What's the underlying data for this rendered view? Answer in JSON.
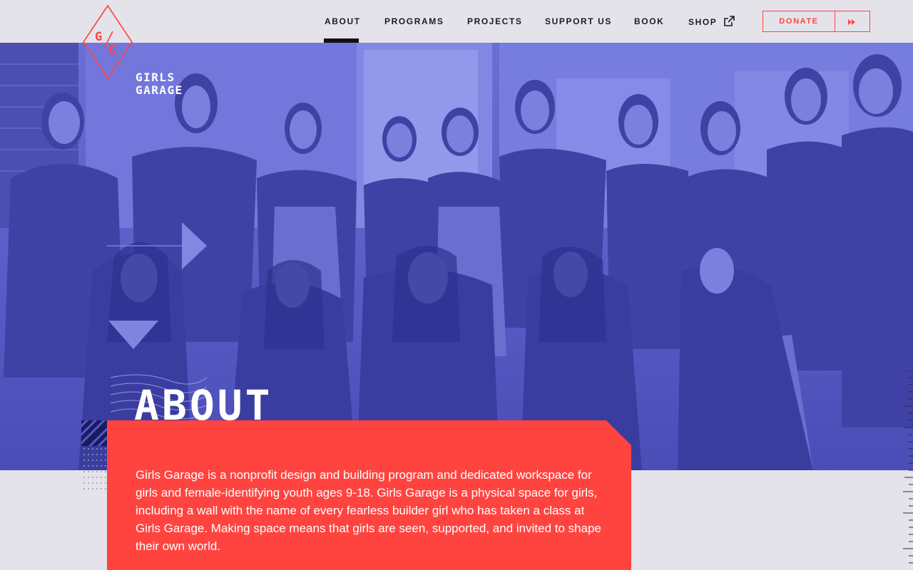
{
  "brand": {
    "monogram": "G/G",
    "name_line1": "GIRLS",
    "name_line2": "GARAGE",
    "color_red": "#ff4440",
    "color_blue": "#5558c4"
  },
  "nav": {
    "items": [
      {
        "label": "ABOUT",
        "active": true
      },
      {
        "label": "PROGRAMS",
        "active": false
      },
      {
        "label": "PROJECTS",
        "active": false
      },
      {
        "label": "SUPPORT US",
        "active": false
      },
      {
        "label": "BOOK",
        "active": false
      },
      {
        "label": "SHOP",
        "active": false
      }
    ],
    "shop_icon": "external-link-icon",
    "donate_label": "DONATE",
    "donate_icon": "fast-forward-icon"
  },
  "hero": {
    "title": "ABOUT",
    "image": "group-photo-of-girls-with-tools"
  },
  "intro": {
    "text": "Girls Garage is a nonprofit design and building program and dedicated workspace for girls and female-identifying youth ages 9-18. Girls Garage is a physical space for girls, including a wall with the name of every fearless builder girl who has taken a class at Girls Garage. Making space means that girls are seen, supported, and invited to shape their own world."
  }
}
